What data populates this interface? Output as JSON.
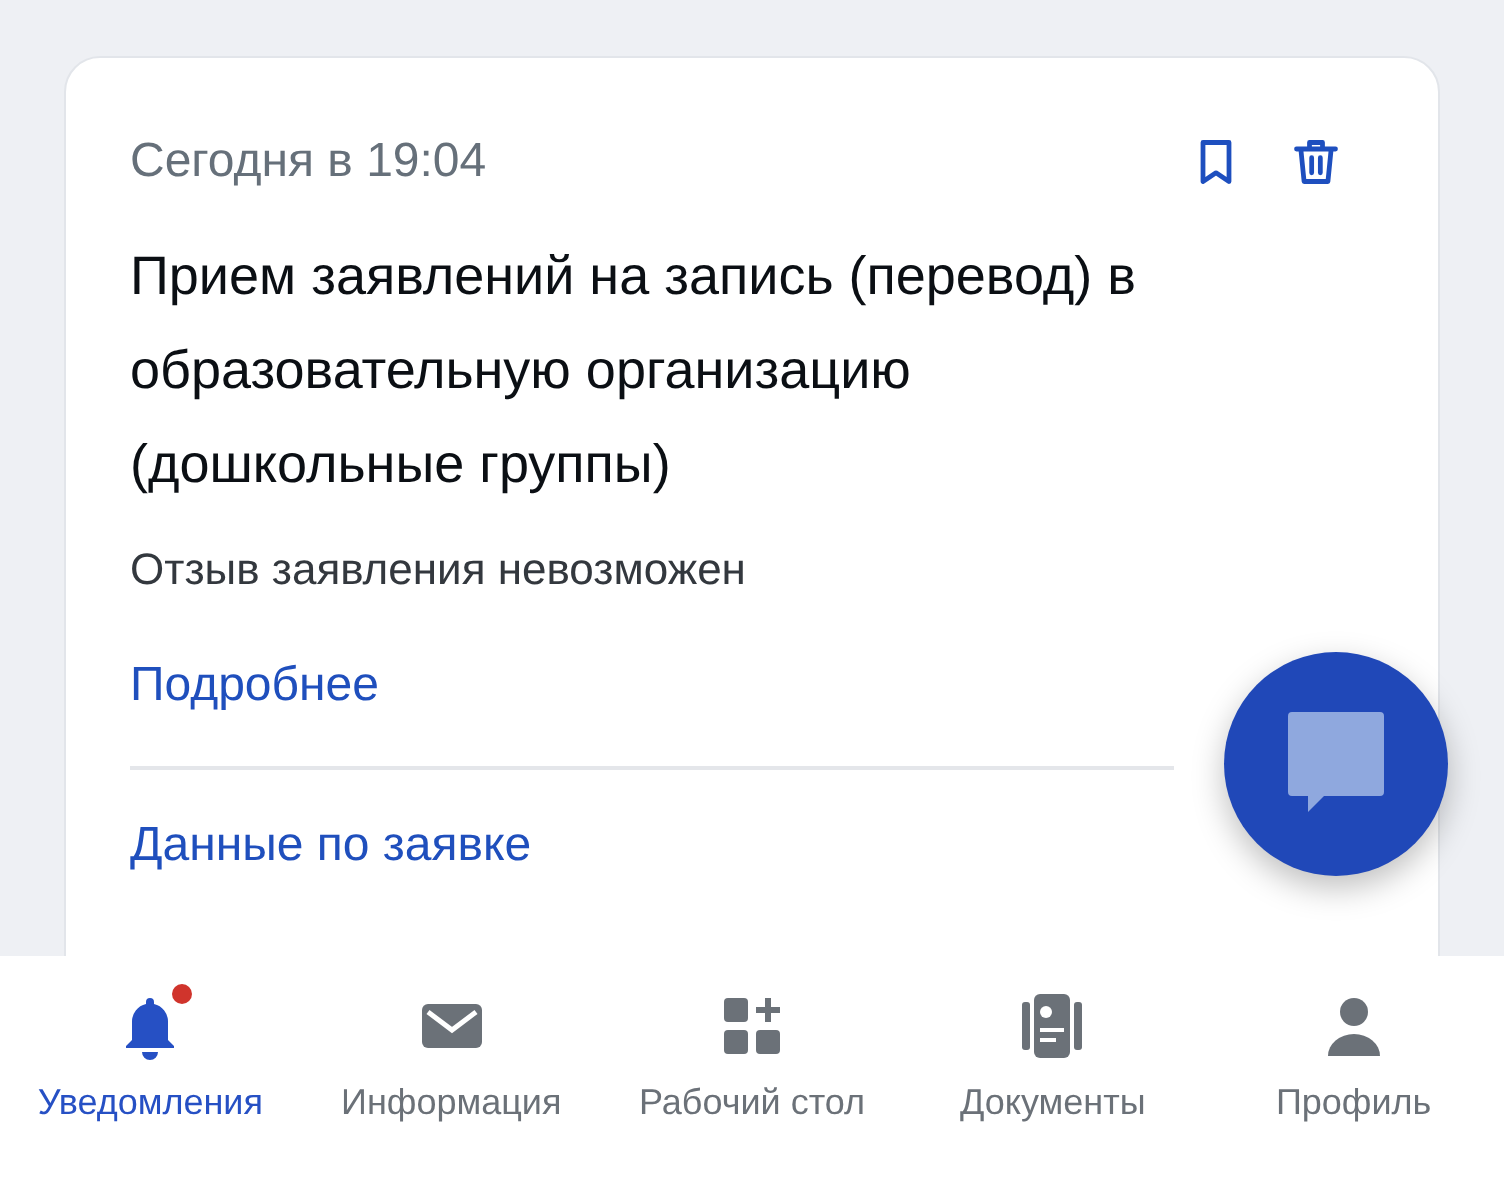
{
  "notification": {
    "date": "Сегодня в 19:04",
    "title": "Прием заявлений на запись (перевод) в образовательную организацию (дошкольные группы)",
    "status": "Отзыв заявления невозможен",
    "links": [
      "Подробнее",
      "Данные по заявке"
    ]
  },
  "bottom_nav": [
    {
      "label": "Уведомления",
      "selected": true,
      "has_badge": true
    },
    {
      "label": "Информация",
      "selected": false,
      "has_badge": false
    },
    {
      "label": "Рабочий стол",
      "selected": false,
      "has_badge": false
    },
    {
      "label": "Документы",
      "selected": false,
      "has_badge": false
    },
    {
      "label": "Профиль",
      "selected": false,
      "has_badge": false
    }
  ]
}
